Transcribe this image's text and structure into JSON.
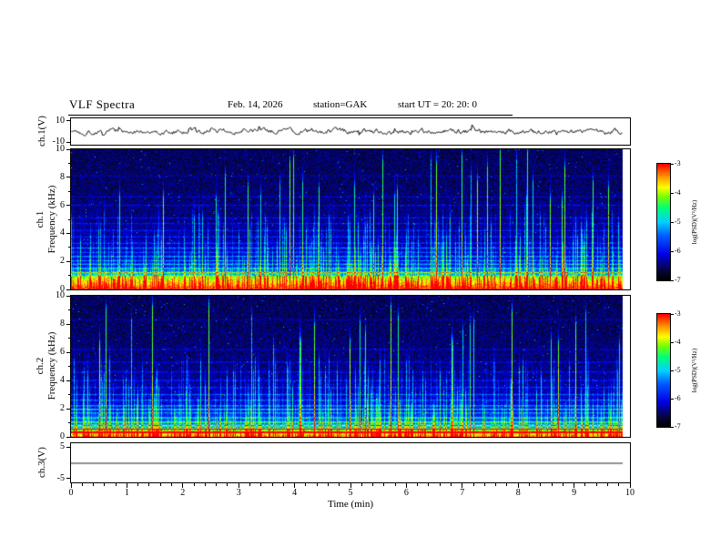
{
  "header": {
    "title": "VLF Spectra",
    "date": "Feb. 14, 2026",
    "station": "station=GAK",
    "start_ut": "start UT =  20: 20: 0"
  },
  "x_axis": {
    "label": "Time (min)",
    "min": 0,
    "max": 10,
    "ticks": [
      "0",
      "1",
      "2",
      "3",
      "4",
      "5",
      "6",
      "7",
      "8",
      "9",
      "10"
    ]
  },
  "panels": {
    "wave1": {
      "ylabel": "ch.1(V)",
      "ytick_labels": [
        "10",
        "-10"
      ],
      "ytick_values": [
        10,
        -10
      ],
      "ylim": [
        -12.5,
        12.5
      ]
    },
    "spec1": {
      "ylabel_line1": "ch.1",
      "ylabel_line2": "Frequency (kHz)",
      "ytick_values": [
        0,
        2,
        4,
        6,
        8,
        10
      ],
      "ylim": [
        0,
        10
      ]
    },
    "spec2": {
      "ylabel_line1": "ch.2",
      "ylabel_line2": "Frequency (kHz)",
      "ytick_values": [
        0,
        2,
        4,
        6,
        8,
        10
      ],
      "ylim": [
        0,
        10
      ]
    },
    "wave3": {
      "ylabel": "ch.3(V)",
      "ytick_labels": [
        "5",
        "-5"
      ],
      "ytick_values": [
        5,
        -5
      ],
      "ylim": [
        -6.25,
        6.25
      ]
    }
  },
  "colorbar": {
    "label": "log(PSD)(V²/Hz)",
    "tick_values": [
      -3,
      -4,
      -5,
      -6,
      -7
    ],
    "max": -3,
    "min": -7
  },
  "chart_data": [
    {
      "type": "line",
      "name": "ch.1 voltage waveform",
      "ylabel": "ch.1(V)",
      "xlim": [
        0,
        10
      ],
      "ylim": [
        -10,
        10
      ],
      "description": "Continuous noisy time series centred on 0 V with fluctuations of roughly ±2–4 V over the full 10-minute record; trace ends slightly before 10 min.",
      "seed": 20260214
    },
    {
      "type": "heatmap",
      "name": "ch.1 spectrogram",
      "xlabel": "Time (min)",
      "ylabel": "Frequency (kHz)",
      "xlim": [
        0,
        10
      ],
      "ylim": [
        0,
        10
      ],
      "zlabel": "log(PSD)(V²/Hz)",
      "zlim": [
        -7,
        -3
      ],
      "band_top_khz": 1.0,
      "band_peak": 0.97,
      "band_fall": 0.3,
      "horizontal_lines": [
        [
          1.2,
          0.3
        ],
        [
          1.5,
          0.22
        ],
        [
          1.8,
          0.26
        ],
        [
          2.05,
          0.2
        ],
        [
          2.35,
          0.24
        ],
        [
          2.65,
          0.16
        ],
        [
          2.95,
          0.2
        ],
        [
          3.3,
          0.14
        ],
        [
          3.75,
          0.12
        ],
        [
          4.2,
          0.12
        ],
        [
          4.7,
          0.1
        ],
        [
          5.1,
          0.1
        ],
        [
          6.0,
          0.1
        ],
        [
          6.6,
          0.08
        ],
        [
          8.1,
          0.06
        ]
      ],
      "description": "Intense red/yellow band below ~1 kHz (PSD near -3), discrete blue/cyan horizontal lines between 1 and 4 kHz, dark blue/black speckled background above ~4 kHz, frequent vertical green/cyan broadband sferic streaks reaching up to 10 kHz.",
      "seed": 90210
    },
    {
      "type": "heatmap",
      "name": "ch.2 spectrogram",
      "xlabel": "Time (min)",
      "ylabel": "Frequency (kHz)",
      "xlim": [
        0,
        10
      ],
      "ylim": [
        0,
        10
      ],
      "zlabel": "log(PSD)(V²/Hz)",
      "zlim": [
        -7,
        -3
      ],
      "band_top_khz": 0.55,
      "band_peak": 0.9,
      "band_fall": 0.28,
      "horizontal_lines": [
        [
          0.32,
          0.5
        ],
        [
          0.55,
          0.55
        ],
        [
          0.8,
          0.45
        ],
        [
          1.05,
          0.3
        ],
        [
          1.35,
          0.25
        ],
        [
          1.7,
          0.22
        ],
        [
          1.95,
          0.3
        ],
        [
          2.2,
          0.24
        ],
        [
          2.6,
          0.18
        ],
        [
          3.0,
          0.16
        ],
        [
          3.5,
          0.13
        ],
        [
          4.0,
          0.12
        ],
        [
          4.6,
          0.1
        ],
        [
          5.3,
          0.1
        ],
        [
          6.2,
          0.09
        ],
        [
          8.3,
          0.06
        ]
      ],
      "description": "Similar to ch.1 but with a narrower intense band below ~0.6 kHz topped by bright yellow-green horizontal lines near 0.3–0.9 kHz; blue horizontal lines at 1–4 kHz and vertical sferic streaks throughout.",
      "seed": 31337
    },
    {
      "type": "line",
      "name": "ch.3 voltage waveform",
      "ylabel": "ch.3(V)",
      "xlim": [
        0,
        10
      ],
      "ylim": [
        -5,
        5
      ],
      "description": "Flat line at 0 V for the entire record (no signal on channel 3).",
      "seed": 7
    }
  ]
}
